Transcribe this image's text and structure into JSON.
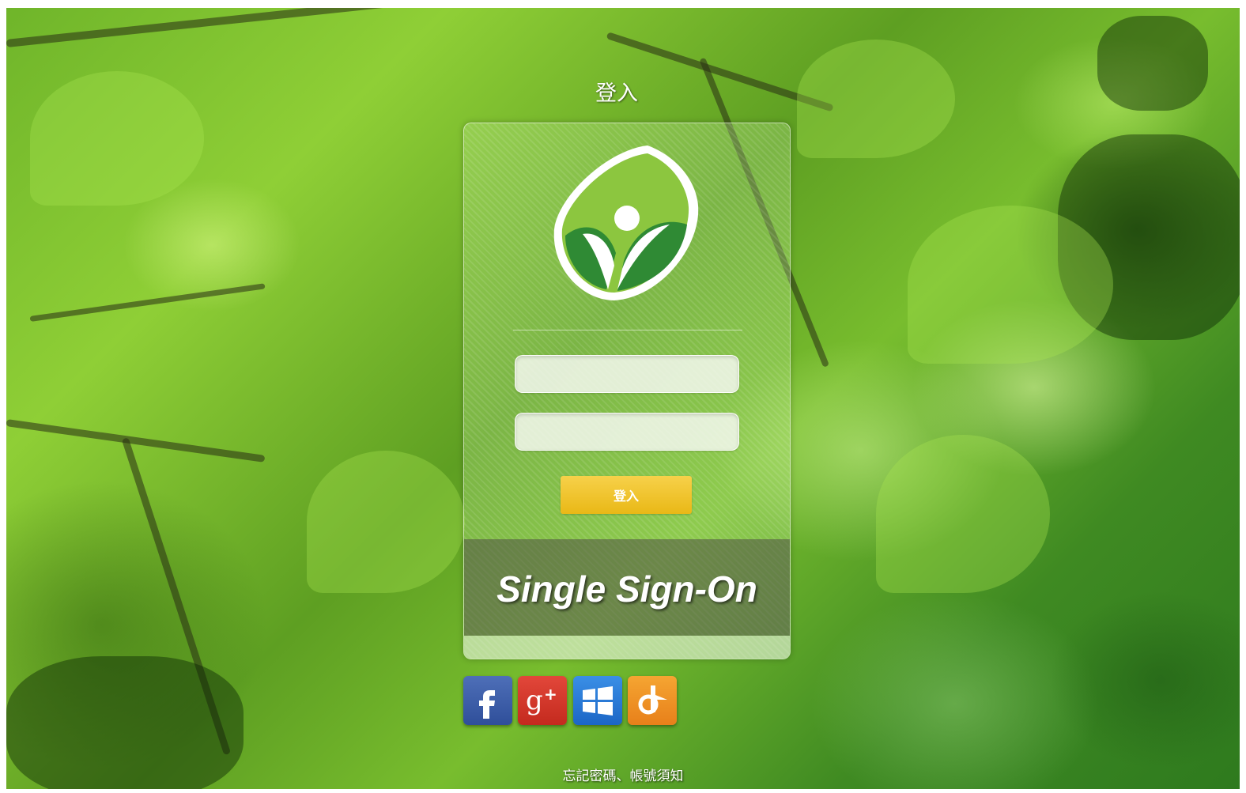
{
  "header": {
    "title": "登入"
  },
  "logo": {
    "icon": "leaf-person-logo-icon"
  },
  "form": {
    "username_value": "",
    "password_value": "",
    "login_button_label": "登入"
  },
  "banner": {
    "text": "Single Sign-On"
  },
  "social_logins": [
    {
      "icon": "facebook-icon",
      "glyph": "f",
      "color": "#3b5998"
    },
    {
      "icon": "google-plus-icon",
      "glyph": "g+",
      "color": "#d73d32"
    },
    {
      "icon": "windows-icon",
      "glyph": "windows",
      "color": "#2a7ad8"
    },
    {
      "icon": "openid-icon",
      "glyph": "o",
      "color": "#f0921f"
    }
  ],
  "footer": {
    "link_text": "忘記密碼、帳號須知"
  },
  "colors": {
    "button": "#f0c22b",
    "background": "#6fb52a"
  }
}
